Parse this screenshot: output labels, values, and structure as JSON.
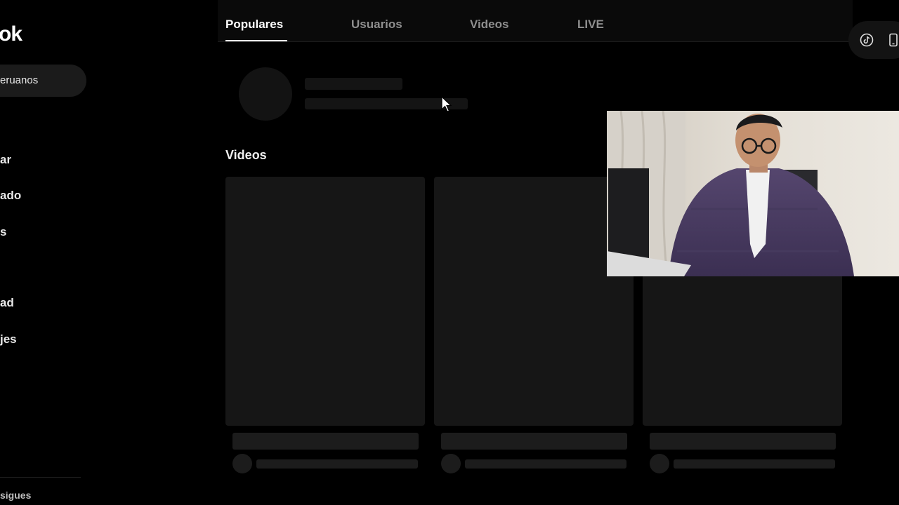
{
  "sidebar": {
    "logo_text": "ok",
    "search_chip": "eruanos",
    "items": [
      {
        "label": "ar"
      },
      {
        "label": "ado"
      },
      {
        "label": "s"
      },
      {
        "label": "ad"
      },
      {
        "label": "jes"
      }
    ],
    "footer_text": "sigues"
  },
  "tabs": [
    {
      "label": "Populares",
      "active": true
    },
    {
      "label": "Usuarios",
      "active": false
    },
    {
      "label": "Videos",
      "active": false
    },
    {
      "label": "LIVE",
      "active": false
    }
  ],
  "sections": {
    "videos_title": "Videos"
  },
  "icons": {
    "pill_left": "tiktok-logo-icon",
    "pill_right": "mobile-device-icon",
    "cursor": "mouse-pointer-icon"
  },
  "colors": {
    "background": "#000000",
    "skeleton": "#161616",
    "tab_inactive": "#8f8f8f",
    "tab_active": "#ffffff"
  }
}
